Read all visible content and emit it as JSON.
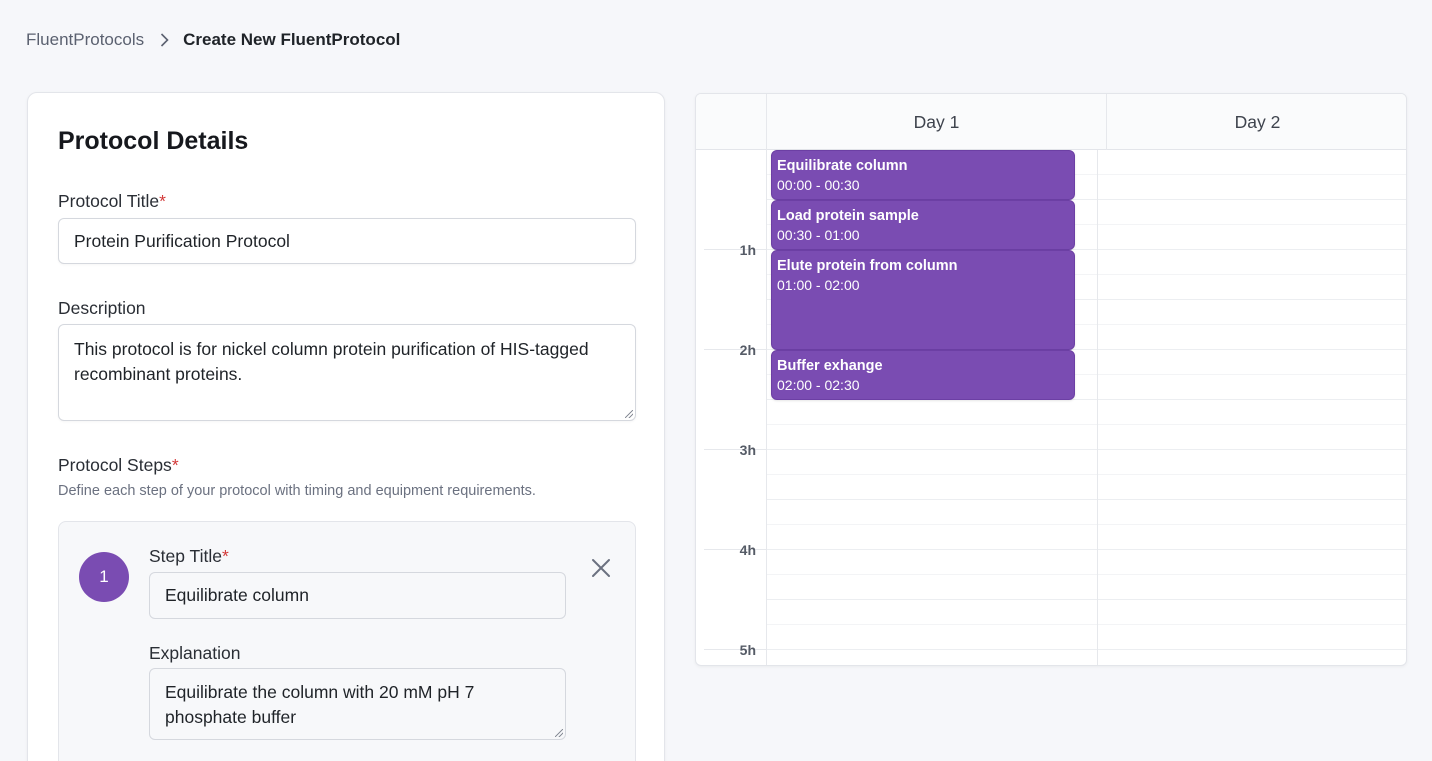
{
  "breadcrumb": {
    "root": "FluentProtocols",
    "current": "Create New FluentProtocol"
  },
  "details": {
    "title": "Protocol Details",
    "protocol_title_label": "Protocol Title",
    "required_mark": "*",
    "protocol_title_value": "Protein Purification Protocol",
    "description_label": "Description",
    "description_value": "This protocol is for nickel column protein purification of HIS-tagged recombinant proteins.",
    "steps_label": "Protocol Steps",
    "steps_hint": "Define each step of your protocol with timing and equipment requirements."
  },
  "steps": [
    {
      "number": "1",
      "title_label": "Step Title",
      "title_value": "Equilibrate column",
      "explanation_label": "Explanation",
      "explanation_value": "Equilibrate the column with 20 mM pH 7 phosphate buffer"
    }
  ],
  "calendar": {
    "days": [
      "Day 1",
      "Day 2"
    ],
    "hour_labels": [
      "1h",
      "2h",
      "3h",
      "4h",
      "5h"
    ],
    "events": [
      {
        "title": "Equilibrate column",
        "time": "00:00 - 00:30"
      },
      {
        "title": "Load protein sample",
        "time": "00:30 - 01:00"
      },
      {
        "title": "Elute protein from column",
        "time": "01:00 - 02:00"
      },
      {
        "title": "Buffer exhange",
        "time": "02:00 - 02:30"
      }
    ]
  },
  "colors": {
    "accent": "#7a4cb2",
    "required": "#d33a3a",
    "background": "#f6f7fa"
  },
  "icons": {
    "breadcrumb_separator": "chevron-right-icon",
    "remove_step": "close-icon"
  }
}
